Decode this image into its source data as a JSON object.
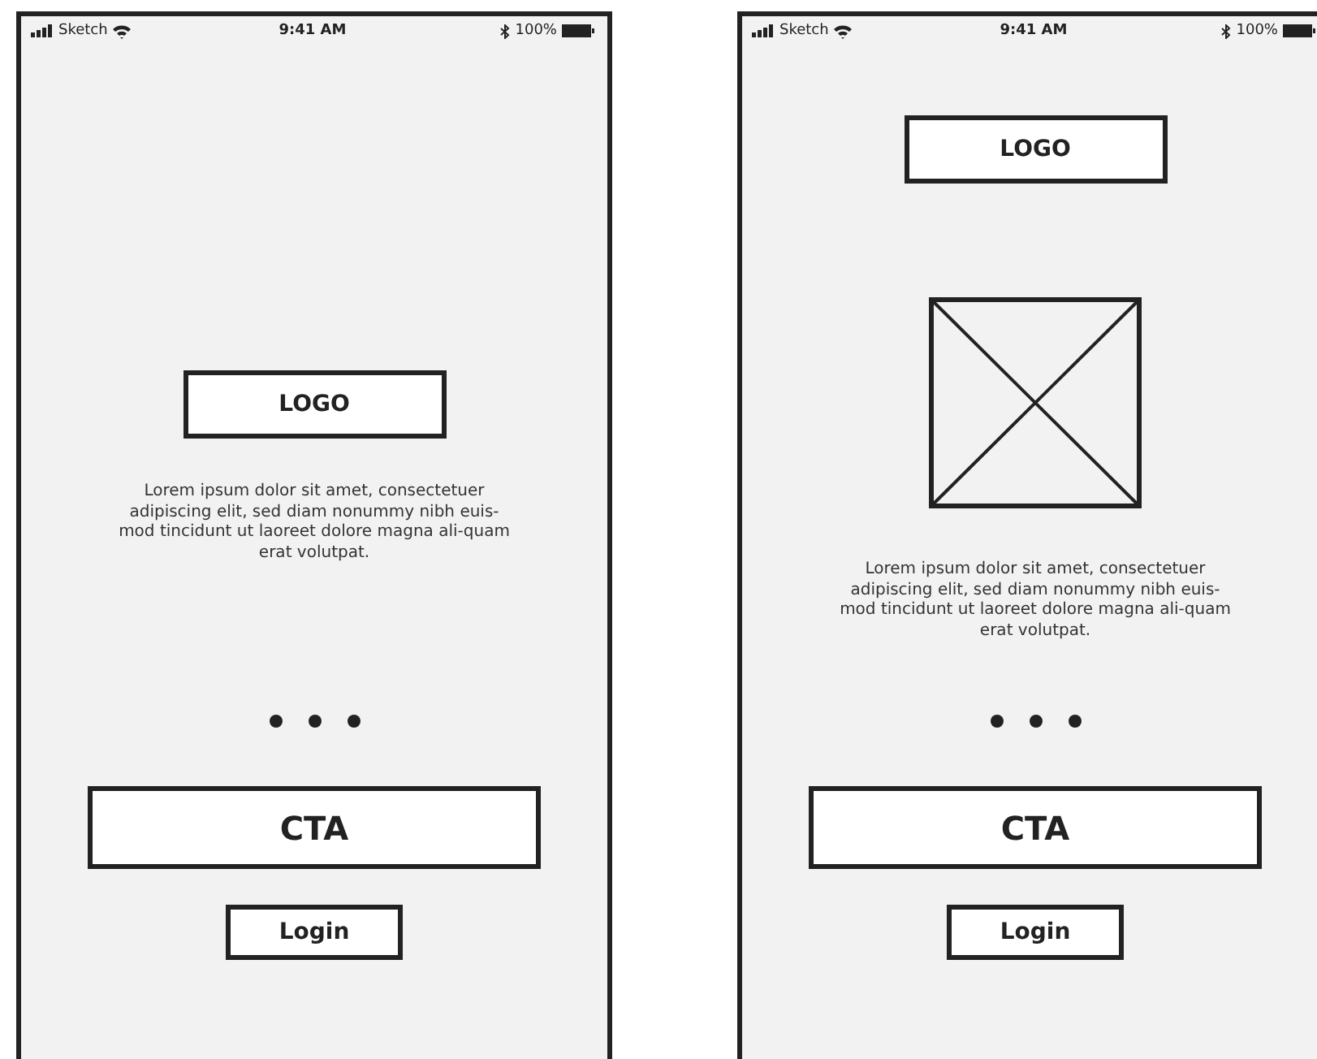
{
  "screens": [
    {
      "status_bar": {
        "carrier": "Sketch",
        "time": "9:41 AM",
        "battery": "100%"
      },
      "items": [
        {
          "kind": "logo",
          "label": "LOGO"
        },
        {
          "kind": "text",
          "text": "Lorem ipsum dolor sit amet, consectetuer adipiscing elit, sed diam nonummy nibh euis-mod tincidunt ut laoreet dolore magna ali-quam erat volutpat."
        },
        {
          "kind": "dots"
        },
        {
          "kind": "cta",
          "label": "CTA"
        },
        {
          "kind": "login",
          "label": "Login"
        }
      ]
    },
    {
      "status_bar": {
        "carrier": "Sketch",
        "time": "9:41 AM",
        "battery": "100%"
      },
      "items": [
        {
          "kind": "logo",
          "label": "LOGO"
        },
        {
          "kind": "image"
        },
        {
          "kind": "text",
          "text": "Lorem ipsum dolor sit amet, consectetuer adipiscing elit, sed diam nonummy nibh euis-mod tincidunt ut laoreet dolore magna ali-quam erat volutpat."
        },
        {
          "kind": "dots"
        },
        {
          "kind": "cta",
          "label": "CTA"
        },
        {
          "kind": "login",
          "label": "Login"
        }
      ]
    }
  ]
}
